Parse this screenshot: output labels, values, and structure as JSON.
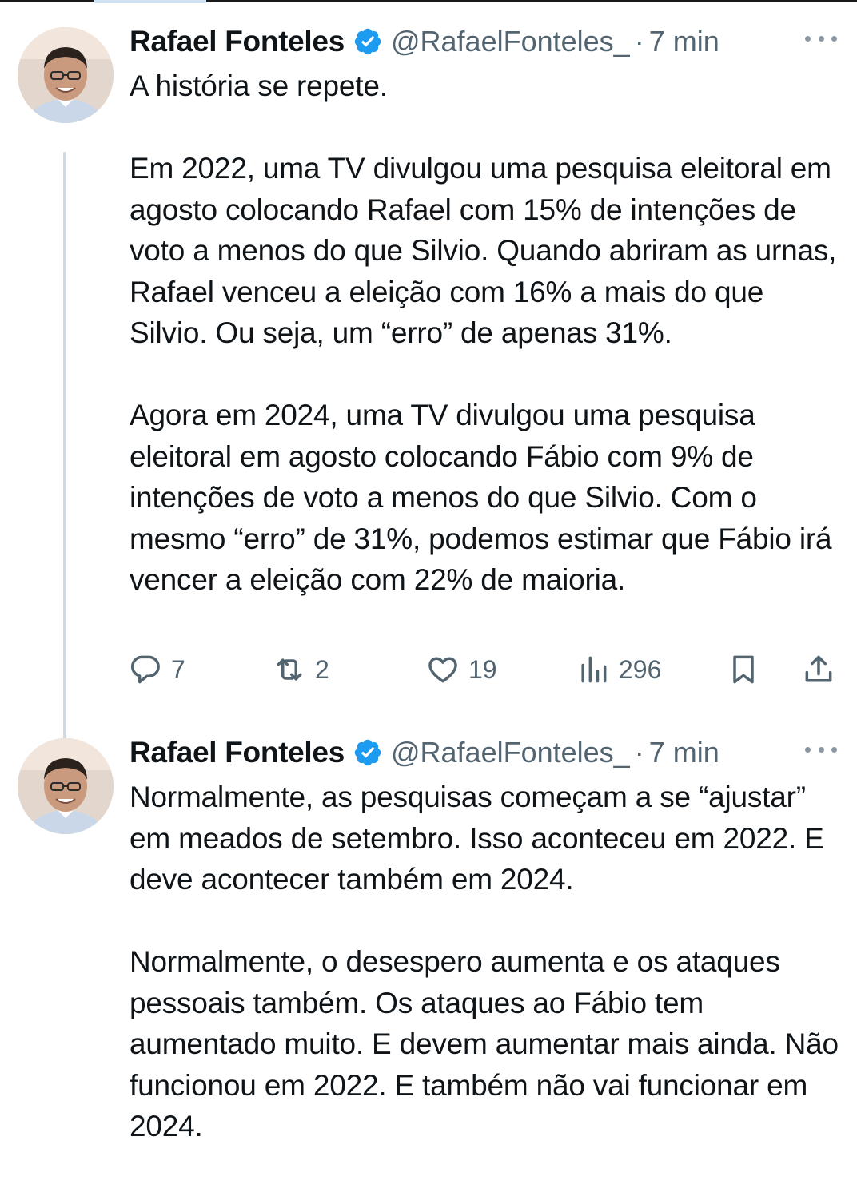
{
  "tweets": [
    {
      "author": {
        "name": "Rafael Fonteles",
        "handle": "@RafaelFonteles_",
        "separator": "·",
        "time": "7 min",
        "verified": true
      },
      "text": "A história se repete.\n\nEm 2022, uma TV divulgou uma pesquisa eleitoral em agosto colocando Rafael com 15% de intenções de voto a menos do que Silvio. Quando abriram as urnas, Rafael venceu a eleição com 16% a mais do que Silvio. Ou seja, um “erro” de apenas 31%.\n\nAgora em 2024, uma TV divulgou uma pesquisa eleitoral em agosto colocando Fábio com 9% de intenções de voto a menos do que Silvio. Com o mesmo “erro” de 31%, podemos estimar que Fábio irá vencer a eleição com 22% de maioria.",
      "actions": {
        "replies": "7",
        "reposts": "2",
        "likes": "19",
        "views": "296"
      }
    },
    {
      "author": {
        "name": "Rafael Fonteles",
        "handle": "@RafaelFonteles_",
        "separator": "·",
        "time": "7 min",
        "verified": true
      },
      "text": "Normalmente, as pesquisas começam a se “ajustar” em meados de setembro. Isso aconteceu em 2022. E deve acontecer também em 2024.\n\nNormalmente, o desespero aumenta e os ataques pessoais também. Os ataques ao Fábio tem aumentado muito. E devem aumentar mais ainda. Não funcionou em 2022. E também não vai funcionar em 2024."
    }
  ],
  "icons": {
    "verified": "verified-badge-icon",
    "more": "more-horizontal-icon",
    "reply": "reply-icon",
    "repost": "repost-icon",
    "like": "heart-icon",
    "views": "views-icon",
    "bookmark": "bookmark-icon",
    "share": "share-icon"
  },
  "colors": {
    "verified": "#1d9bf0",
    "text": "#0f1419",
    "secondary": "#536471",
    "thread_line": "#cfd9de"
  }
}
